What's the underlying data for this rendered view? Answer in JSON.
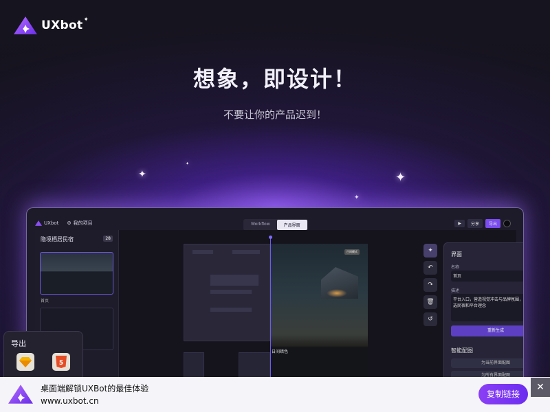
{
  "brand": {
    "name": "UXbot",
    "accent": "#8a3ff5"
  },
  "hero": {
    "title": "想象，即设计！",
    "subtitle": "不要让你的产品迟到！"
  },
  "app": {
    "logo_text": "UXbot",
    "project_label": "我的项目",
    "tabs": [
      {
        "label": "Workflow"
      },
      {
        "label": "产品界面"
      }
    ],
    "actions": {
      "play_icon": "play-icon",
      "share_label": "分享",
      "export_label": "导出"
    },
    "left_panel": {
      "title": "隐境栖居民宿",
      "count": "28",
      "thumb_label": "首页"
    },
    "canvas": {
      "photo_tag": "日间模式",
      "photo_caption": "日间暗色"
    },
    "right_panel": {
      "title": "界面",
      "name_label": "名称",
      "name_value": "首页",
      "desc_label": "描述",
      "desc_value": "平台入口，营造视觉冲击与品牌氛围，展示精选民宿和平台理念",
      "regenerate_label": "重新生成",
      "smart_section": "智能配图",
      "smart_row_1": "为当前界面配图",
      "smart_row_2": "为所有界面配图"
    }
  },
  "export_popup": {
    "title": "导出",
    "items": [
      {
        "icon": "sketch-icon"
      },
      {
        "icon": "html5-icon"
      }
    ]
  },
  "banner": {
    "line1": "桌面端解锁UXBot的最佳体验",
    "line2": "www.uxbot.cn",
    "copy_label": "复制链接",
    "close_label": "✕"
  }
}
